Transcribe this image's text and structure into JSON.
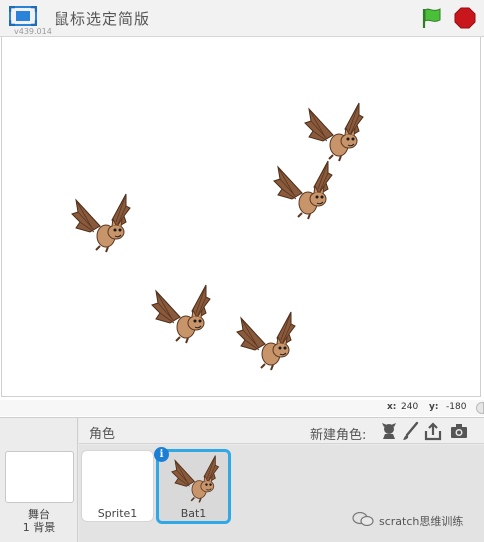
{
  "topbar": {
    "project_title": "鼠标选定简版",
    "version": "v439.014"
  },
  "stage": {
    "sprites": [
      "Bat1",
      "Bat1",
      "Bat1",
      "Bat1",
      "Bat1"
    ]
  },
  "coords": {
    "x_label": "x:",
    "x_value": "240",
    "y_label": "y:",
    "y_value": "-180"
  },
  "bottom": {
    "stage_label_line1": "舞台",
    "stage_label_line2": "1 背景",
    "sprites_title": "角色",
    "new_sprite_label": "新建角色:",
    "sprites": [
      {
        "name": "Sprite1",
        "selected": false
      },
      {
        "name": "Bat1",
        "selected": true
      }
    ],
    "info_badge": "i"
  },
  "watermark": {
    "text": "scratch思维训练"
  },
  "colors": {
    "selected_border": "#30a8e6",
    "flag": "#4cbf3a",
    "stop": "#c9161d",
    "bat_body": "#c8946a",
    "bat_wing": "#8a5a3c"
  },
  "icons": {
    "fullscreen": "fullscreen-icon",
    "green_flag": "green-flag-icon",
    "stop": "stop-icon",
    "library": "sprite-library-icon",
    "paint": "paintbrush-icon",
    "upload": "upload-icon",
    "camera": "camera-icon"
  }
}
